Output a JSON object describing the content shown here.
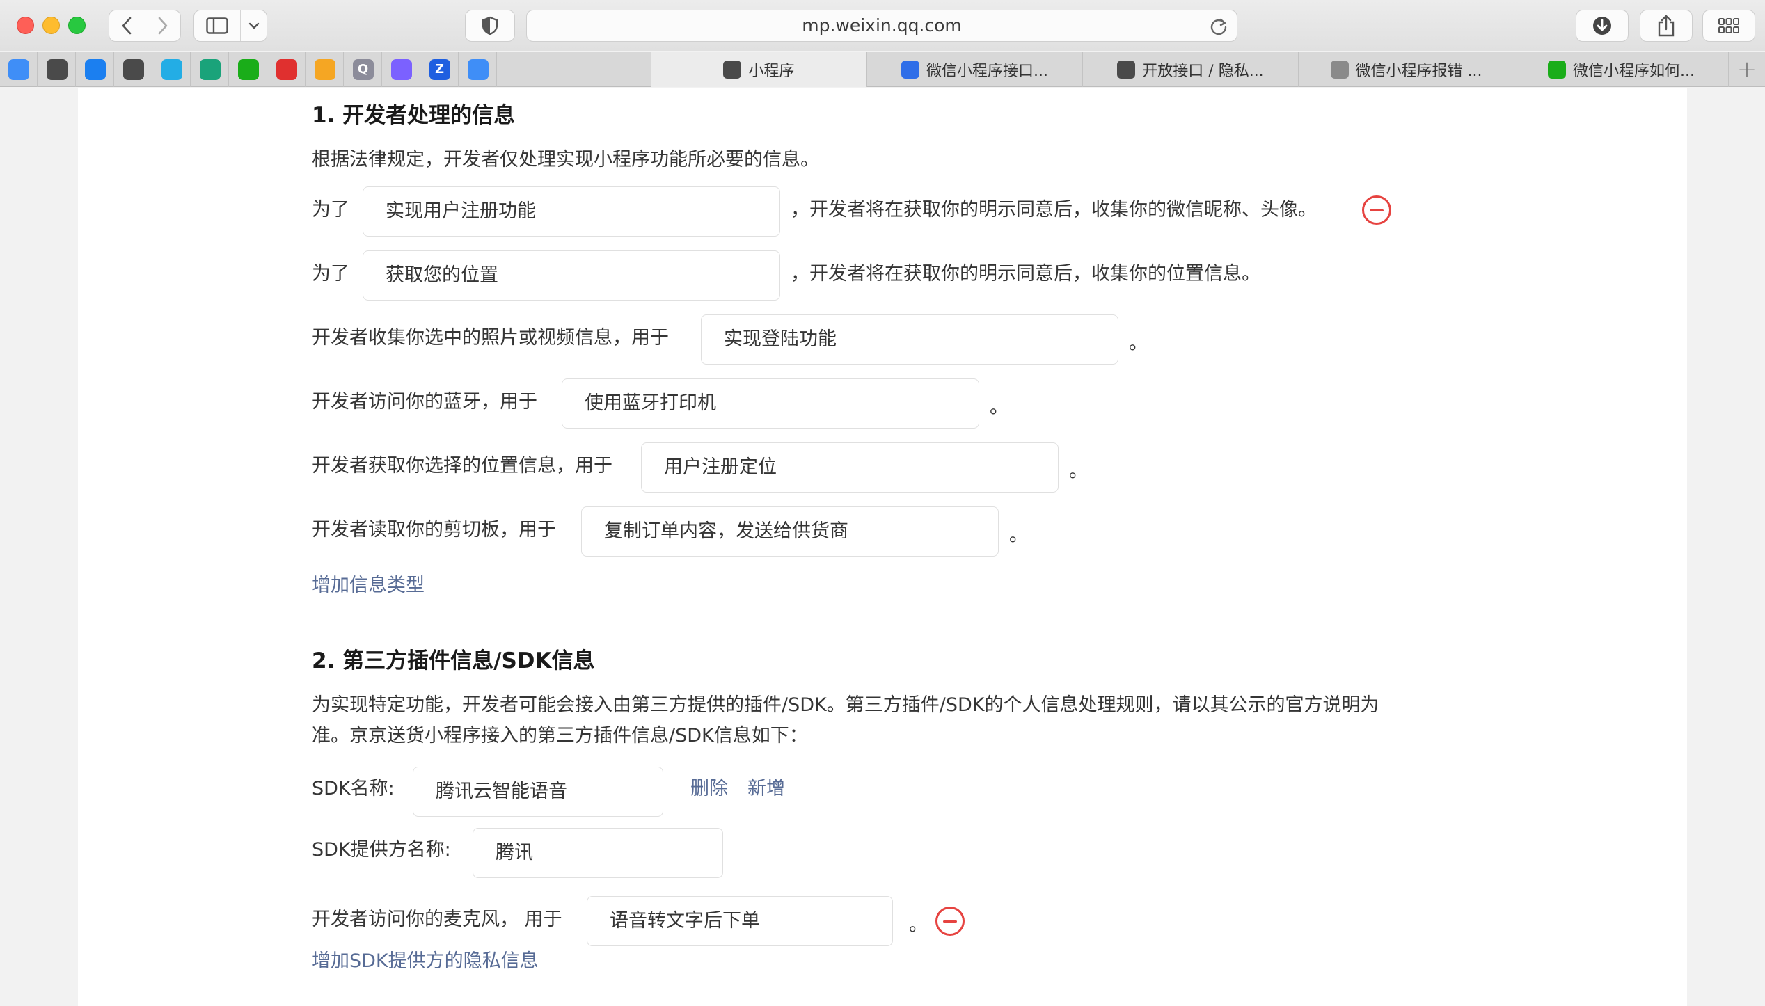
{
  "browser": {
    "url": "mp.weixin.qq.com",
    "favorites": [
      {
        "icon": "cloud-icon",
        "label": "",
        "color": "#3f8ef7"
      },
      {
        "icon": "wechat-icon",
        "label": "",
        "color": "#4a4a4a"
      },
      {
        "icon": "chat-bubble-icon",
        "label": "",
        "color": "#1b7ff0"
      },
      {
        "icon": "wechat-icon",
        "label": "",
        "color": "#4a4a4a"
      },
      {
        "icon": "bilibili-icon",
        "label": "",
        "color": "#23ade5"
      },
      {
        "icon": "owl-icon",
        "label": "",
        "color": "#1aa37a"
      },
      {
        "icon": "green-leaf-icon",
        "label": "",
        "color": "#1aad19"
      },
      {
        "icon": "music-note-icon",
        "label": "",
        "color": "#e0302f"
      },
      {
        "icon": "butterfly-icon",
        "label": "",
        "color": "#f5a623"
      },
      {
        "icon": "q-letter-icon",
        "label": "Q",
        "color": "#8c8c9a"
      },
      {
        "icon": "photo-icon",
        "label": "",
        "color": "#7b61ff"
      },
      {
        "icon": "z-letter-icon",
        "label": "Z",
        "color": "#1f5fe0"
      },
      {
        "icon": "cloud-icon",
        "label": "",
        "color": "#3f8ef7"
      }
    ],
    "tabs": [
      {
        "label": "小程序",
        "icon": "wechat-icon",
        "color": "#4a4a4a",
        "active": true
      },
      {
        "label": "微信小程序接口...",
        "icon": "baidu-paw-icon",
        "color": "#2f6ee8",
        "active": false
      },
      {
        "label": "开放接口 / 隐私...",
        "icon": "wechat-icon",
        "color": "#4a4a4a",
        "active": false
      },
      {
        "label": "微信小程序报错 ...",
        "icon": "c-letter-icon",
        "color": "#8a8a8a",
        "active": false
      },
      {
        "label": "微信小程序如何...",
        "icon": "green-circle-icon",
        "color": "#1aad19",
        "active": false
      }
    ]
  },
  "section1": {
    "title": "1.  开发者处理的信息",
    "intro": "根据法律规定，开发者仅处理实现小程序功能所必要的信息。",
    "rows": [
      {
        "prefix": "为了",
        "value": "实现用户注册功能",
        "suffix": "，开发者将在获取你的明示同意后，收集你的微信昵称、头像。"
      },
      {
        "prefix": "为了",
        "value": "获取您的位置",
        "suffix": "，开发者将在获取你的明示同意后，收集你的位置信息。"
      },
      {
        "prefix": "开发者收集你选中的照片或视频信息，用于",
        "value": "实现登陆功能",
        "suffix": "。"
      },
      {
        "prefix": "开发者访问你的蓝牙，用于",
        "value": "使用蓝牙打印机",
        "suffix": "。"
      },
      {
        "prefix": "开发者获取你选择的位置信息，用于",
        "value": "用户注册定位",
        "suffix": "。"
      },
      {
        "prefix": "开发者读取你的剪切板，用于",
        "value": "复制订单内容，发送给供货商",
        "suffix": "。"
      }
    ],
    "add_link": "增加信息类型"
  },
  "section2": {
    "title": "2.  第三方插件信息/SDK信息",
    "intro_line1": "为实现特定功能，开发者可能会接入由第三方提供的插件/SDK。第三方插件/SDK的个人信息处理规则，请以其公示的官方说明为",
    "intro_line2": "准。京京送货小程序接入的第三方插件信息/SDK信息如下：",
    "sdk_name_label": "SDK名称:",
    "sdk_name_value": "腾讯云智能语音",
    "delete_label": "删除",
    "add_label": "新增",
    "provider_label": "SDK提供方名称:",
    "provider_value": "腾讯",
    "mic_prefix": "开发者访问你的麦克风，  用于",
    "mic_value": "语音转文字后下单",
    "mic_suffix": "。",
    "add_link": "增加SDK提供方的隐私信息"
  }
}
